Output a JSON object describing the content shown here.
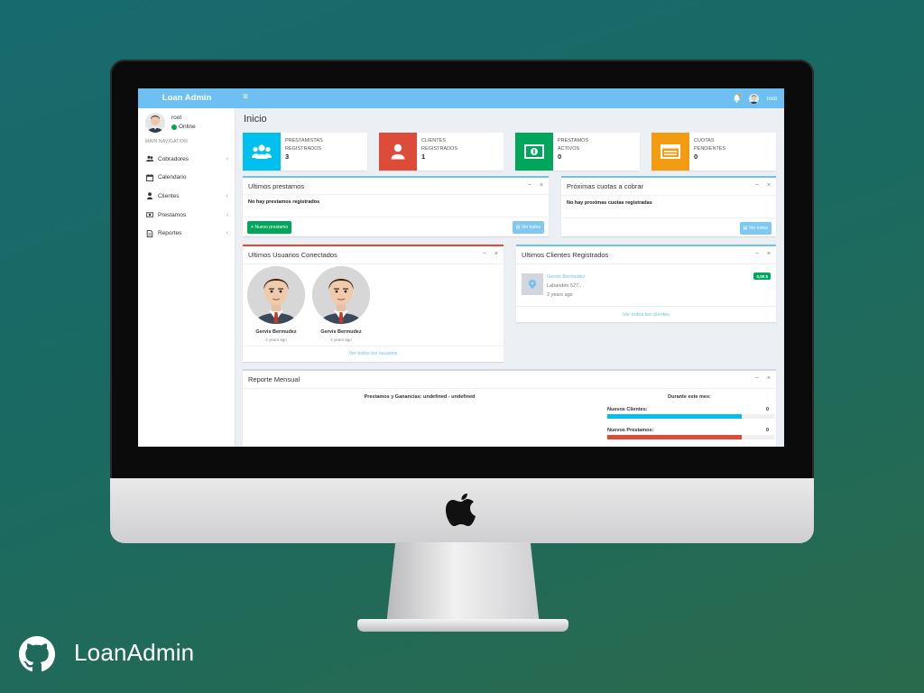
{
  "app": {
    "logo": "Loan Admin",
    "user": "root"
  },
  "sidebar": {
    "user_name": "root",
    "status": "Online",
    "nav_header": "MAIN NAVIGATION",
    "items": [
      {
        "label": "Cobradores",
        "icon": "users-icon",
        "has_chevron": true
      },
      {
        "label": "Calendario",
        "icon": "calendar-icon",
        "has_chevron": false
      },
      {
        "label": "Clientes",
        "icon": "user-icon",
        "has_chevron": true
      },
      {
        "label": "Prestamos",
        "icon": "money-icon",
        "has_chevron": true
      },
      {
        "label": "Reportes",
        "icon": "file-icon",
        "has_chevron": true
      }
    ]
  },
  "page": {
    "title": "Inicio"
  },
  "info_boxes": [
    {
      "line1": "PRESTAMISTAS",
      "line2": "REGISTRADOS",
      "value": "3",
      "color": "#00c0ef",
      "icon": "users-icon"
    },
    {
      "line1": "CLIENTES",
      "line2": "REGISTRADOS",
      "value": "1",
      "color": "#dd4b39",
      "icon": "user-icon"
    },
    {
      "line1": "PRESTAMOS",
      "line2": "ACTIVOS",
      "value": "0",
      "color": "#00a65a",
      "icon": "money-icon"
    },
    {
      "line1": "CUOTAS",
      "line2": "PENDIENTES",
      "value": "0",
      "color": "#f39c12",
      "icon": "list-icon"
    }
  ],
  "loans_box": {
    "title": "Ultimos prestamos",
    "empty": "No hay prestamos registrados",
    "new_button": "Nuevo prestamo",
    "view_button": "Ver todos"
  },
  "quotas_box": {
    "title": "Próximas cuotas a cobrar",
    "empty": "No hay proximas cuotas registradas",
    "view_button": "Ver todos"
  },
  "users_box": {
    "title": "Ultimos Usuarios Conectados",
    "users": [
      {
        "name": "Gervis Bermudez",
        "time": "2 years ago"
      },
      {
        "name": "Gervis Bermudez",
        "time": "2 years ago"
      }
    ],
    "footer": "Ver todos los usuarios"
  },
  "clients_box": {
    "title": "Ultimos Clientes Registrados",
    "client": {
      "name": "Gervis Bermudez",
      "address": "Labandén 527,,",
      "time": "2 years ago",
      "badge": "0,00 $"
    },
    "footer": "Ver todos los clientes"
  },
  "report_box": {
    "title": "Reporte Mensual",
    "heading": "Prestamos y Ganancias: undefined - undefined",
    "period": "Durante este mes:",
    "bars": [
      {
        "label": "Nuevos Clientes:",
        "value": "0",
        "color": "#00c0ef",
        "fill": 0.8
      },
      {
        "label": "Nuevos Prestamos:",
        "value": "0",
        "color": "#dd4b39",
        "fill": 0.8
      }
    ]
  },
  "caption": {
    "brand": "LoanAdmin"
  }
}
